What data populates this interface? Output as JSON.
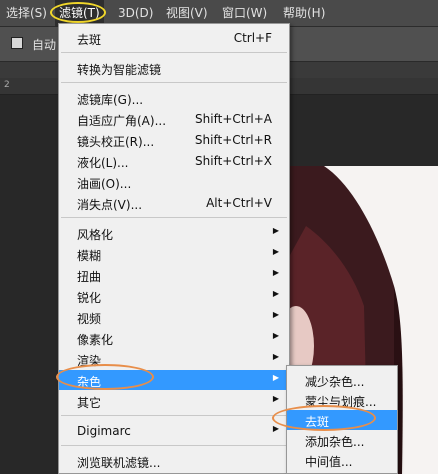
{
  "menubar": {
    "items": [
      {
        "label": "选择(S)"
      },
      {
        "label": "滤镜(T)"
      },
      {
        "label": "3D(D)"
      },
      {
        "label": "视图(V)"
      },
      {
        "label": "窗口(W)"
      },
      {
        "label": "帮助(H)"
      }
    ]
  },
  "options": {
    "auto_label": "自动"
  },
  "ruler": {
    "mark": "2"
  },
  "filter_menu": {
    "items": [
      {
        "label": "去斑",
        "shortcut": "Ctrl+F"
      },
      {
        "label": "转换为智能滤镜",
        "shortcut": ""
      },
      {
        "label": "滤镜库(G)...",
        "shortcut": ""
      },
      {
        "label": "自适应广角(A)...",
        "shortcut": "Shift+Ctrl+A"
      },
      {
        "label": "镜头校正(R)...",
        "shortcut": "Shift+Ctrl+R"
      },
      {
        "label": "液化(L)...",
        "shortcut": "Shift+Ctrl+X"
      },
      {
        "label": "油画(O)...",
        "shortcut": ""
      },
      {
        "label": "消失点(V)...",
        "shortcut": "Alt+Ctrl+V"
      },
      {
        "label": "风格化",
        "shortcut": ""
      },
      {
        "label": "模糊",
        "shortcut": ""
      },
      {
        "label": "扭曲",
        "shortcut": ""
      },
      {
        "label": "锐化",
        "shortcut": ""
      },
      {
        "label": "视频",
        "shortcut": ""
      },
      {
        "label": "像素化",
        "shortcut": ""
      },
      {
        "label": "渲染",
        "shortcut": ""
      },
      {
        "label": "杂色",
        "shortcut": ""
      },
      {
        "label": "其它",
        "shortcut": ""
      },
      {
        "label": "Digimarc",
        "shortcut": ""
      },
      {
        "label": "浏览联机滤镜...",
        "shortcut": ""
      }
    ]
  },
  "noise_submenu": {
    "items": [
      {
        "label": "减少杂色..."
      },
      {
        "label": "蒙尘与划痕..."
      },
      {
        "label": "去斑"
      },
      {
        "label": "添加杂色..."
      },
      {
        "label": "中间值..."
      }
    ]
  },
  "colors": {
    "highlight": "#3399ff",
    "menu_bg": "#f0f0f0",
    "yellow_mark": "#f1d72b",
    "orange_mark": "#e88e4a"
  }
}
